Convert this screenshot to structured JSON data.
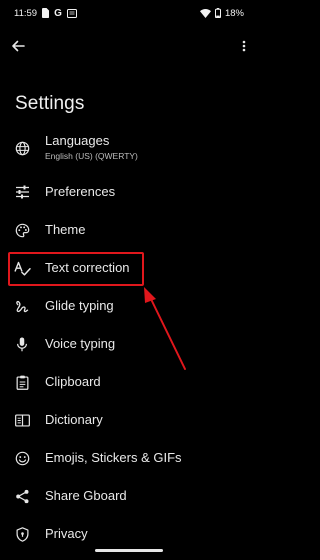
{
  "status_bar": {
    "time": "11:59",
    "battery": "18%"
  },
  "header": {
    "title": "Settings"
  },
  "menu": {
    "items": [
      {
        "label": "Languages",
        "sub": "English (US) (QWERTY)"
      },
      {
        "label": "Preferences"
      },
      {
        "label": "Theme"
      },
      {
        "label": "Text correction"
      },
      {
        "label": "Glide typing"
      },
      {
        "label": "Voice typing"
      },
      {
        "label": "Clipboard"
      },
      {
        "label": "Dictionary"
      },
      {
        "label": "Emojis, Stickers & GIFs"
      },
      {
        "label": "Share Gboard"
      },
      {
        "label": "Privacy"
      }
    ]
  },
  "annotation": {
    "color": "#e0171c"
  }
}
